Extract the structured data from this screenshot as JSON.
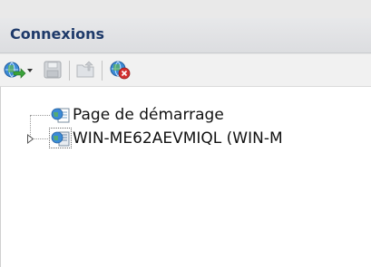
{
  "pane": {
    "title": "Connexions"
  },
  "toolbar": {
    "items": [
      {
        "name": "connect",
        "icon": "globe-connect-icon",
        "has_dropdown": true
      },
      {
        "name": "save",
        "icon": "save-icon",
        "enabled": false
      },
      {
        "name": "up",
        "icon": "folder-up-icon",
        "enabled": false
      },
      {
        "name": "disconnect",
        "icon": "disconnect-icon",
        "enabled": true
      }
    ]
  },
  "tree": {
    "nodes": [
      {
        "label": "Page de démarrage",
        "icon": "start-page-icon",
        "expandable": false
      },
      {
        "label": "WIN-ME62AEVMIQL (WIN-M",
        "icon": "server-icon",
        "expandable": true,
        "expanded": false
      }
    ]
  },
  "colors": {
    "title": "#1e3a6a",
    "header_bg": "#e1e2e5",
    "tree_bg": "#ffffff"
  }
}
